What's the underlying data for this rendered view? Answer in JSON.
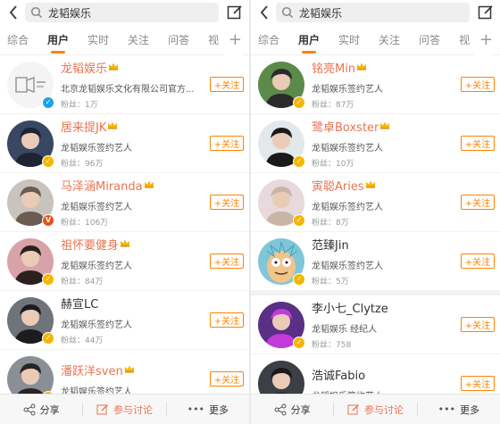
{
  "search": {
    "query": "龙韬娱乐"
  },
  "tabs": [
    "综合",
    "用户",
    "实时",
    "关注",
    "问答",
    "视"
  ],
  "active_tab": 1,
  "colors": {
    "accent": "#ff8200",
    "name_highlight": "#eb7350",
    "vip_gold": "#f7b500",
    "verified_blue": "#1aa3e8"
  },
  "follow_label": "+关注",
  "bottom_bar": {
    "share": "分享",
    "discuss": "参与讨论",
    "more": "更多"
  },
  "left_list": [
    {
      "name": "龙韬娱乐",
      "desc": "北京龙韬娱乐文化有限公司官方...",
      "fans": "粉丝：1万",
      "badge": "blue",
      "crown": true,
      "highlight": true
    },
    {
      "name": "居来提JK",
      "desc": "龙韬娱乐签约艺人",
      "fans": "粉丝：96万",
      "badge": "gold",
      "crown": true,
      "highlight": true
    },
    {
      "name": "马泽涵Miranda",
      "desc": "龙韬娱乐签约艺人",
      "fans": "粉丝：106万",
      "badge": "orange",
      "crown": true,
      "highlight": true
    },
    {
      "name": "祖怀要健身",
      "desc": "龙韬娱乐签约艺人",
      "fans": "粉丝：84万",
      "badge": "gold",
      "crown": true,
      "highlight": true
    },
    {
      "name": "赫宣LC",
      "desc": "龙韬娱乐签约艺人",
      "fans": "粉丝：44万",
      "badge": "gold",
      "crown": false,
      "highlight": false
    },
    {
      "name": "潘跃洋sven",
      "desc": "龙韬娱乐签约艺人",
      "fans": "",
      "badge": "gold",
      "crown": true,
      "highlight": true
    }
  ],
  "right_list": [
    {
      "name": "铭亮Min",
      "desc": "龙韬娱乐签约艺人",
      "fans": "粉丝：87万",
      "badge": "gold",
      "crown": true,
      "highlight": true
    },
    {
      "name": "鹭卓Boxster",
      "desc": "龙韬娱乐签约艺人",
      "fans": "粉丝：10万",
      "badge": "gold",
      "crown": true,
      "highlight": true
    },
    {
      "name": "寅聪Aries",
      "desc": "龙韬娱乐签约艺人",
      "fans": "粉丝：8万",
      "badge": "gold",
      "crown": true,
      "highlight": true
    },
    {
      "name": "范臻Jin",
      "desc": "龙韬娱乐签约艺人",
      "fans": "粉丝：5万",
      "badge": "gold",
      "crown": false,
      "highlight": false
    },
    {
      "name": "李小七_Clytze",
      "desc": "龙韬娱乐 经纪人",
      "fans": "粉丝：758",
      "badge": "gold",
      "crown": false,
      "highlight": false
    },
    {
      "name": "浩诚Fabio",
      "desc": "龙韬娱乐签约艺人",
      "fans": "",
      "badge": "gold",
      "crown": false,
      "highlight": false
    }
  ]
}
